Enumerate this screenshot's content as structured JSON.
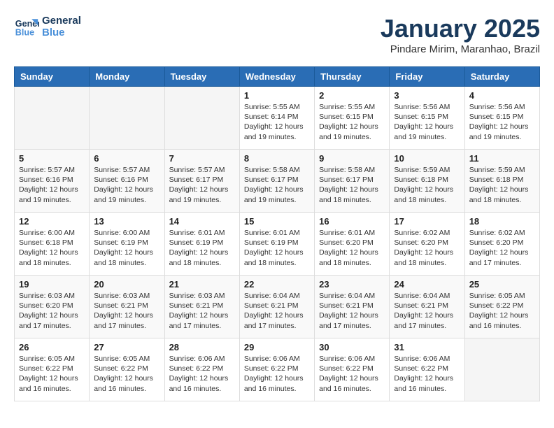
{
  "logo": {
    "line1": "General",
    "line2": "Blue"
  },
  "title": "January 2025",
  "location": "Pindare Mirim, Maranhao, Brazil",
  "weekdays": [
    "Sunday",
    "Monday",
    "Tuesday",
    "Wednesday",
    "Thursday",
    "Friday",
    "Saturday"
  ],
  "weeks": [
    [
      {
        "day": "",
        "text": ""
      },
      {
        "day": "",
        "text": ""
      },
      {
        "day": "",
        "text": ""
      },
      {
        "day": "1",
        "text": "Sunrise: 5:55 AM\nSunset: 6:14 PM\nDaylight: 12 hours\nand 19 minutes."
      },
      {
        "day": "2",
        "text": "Sunrise: 5:55 AM\nSunset: 6:15 PM\nDaylight: 12 hours\nand 19 minutes."
      },
      {
        "day": "3",
        "text": "Sunrise: 5:56 AM\nSunset: 6:15 PM\nDaylight: 12 hours\nand 19 minutes."
      },
      {
        "day": "4",
        "text": "Sunrise: 5:56 AM\nSunset: 6:15 PM\nDaylight: 12 hours\nand 19 minutes."
      }
    ],
    [
      {
        "day": "5",
        "text": "Sunrise: 5:57 AM\nSunset: 6:16 PM\nDaylight: 12 hours\nand 19 minutes."
      },
      {
        "day": "6",
        "text": "Sunrise: 5:57 AM\nSunset: 6:16 PM\nDaylight: 12 hours\nand 19 minutes."
      },
      {
        "day": "7",
        "text": "Sunrise: 5:57 AM\nSunset: 6:17 PM\nDaylight: 12 hours\nand 19 minutes."
      },
      {
        "day": "8",
        "text": "Sunrise: 5:58 AM\nSunset: 6:17 PM\nDaylight: 12 hours\nand 19 minutes."
      },
      {
        "day": "9",
        "text": "Sunrise: 5:58 AM\nSunset: 6:17 PM\nDaylight: 12 hours\nand 18 minutes."
      },
      {
        "day": "10",
        "text": "Sunrise: 5:59 AM\nSunset: 6:18 PM\nDaylight: 12 hours\nand 18 minutes."
      },
      {
        "day": "11",
        "text": "Sunrise: 5:59 AM\nSunset: 6:18 PM\nDaylight: 12 hours\nand 18 minutes."
      }
    ],
    [
      {
        "day": "12",
        "text": "Sunrise: 6:00 AM\nSunset: 6:18 PM\nDaylight: 12 hours\nand 18 minutes."
      },
      {
        "day": "13",
        "text": "Sunrise: 6:00 AM\nSunset: 6:19 PM\nDaylight: 12 hours\nand 18 minutes."
      },
      {
        "day": "14",
        "text": "Sunrise: 6:01 AM\nSunset: 6:19 PM\nDaylight: 12 hours\nand 18 minutes."
      },
      {
        "day": "15",
        "text": "Sunrise: 6:01 AM\nSunset: 6:19 PM\nDaylight: 12 hours\nand 18 minutes."
      },
      {
        "day": "16",
        "text": "Sunrise: 6:01 AM\nSunset: 6:20 PM\nDaylight: 12 hours\nand 18 minutes."
      },
      {
        "day": "17",
        "text": "Sunrise: 6:02 AM\nSunset: 6:20 PM\nDaylight: 12 hours\nand 18 minutes."
      },
      {
        "day": "18",
        "text": "Sunrise: 6:02 AM\nSunset: 6:20 PM\nDaylight: 12 hours\nand 17 minutes."
      }
    ],
    [
      {
        "day": "19",
        "text": "Sunrise: 6:03 AM\nSunset: 6:20 PM\nDaylight: 12 hours\nand 17 minutes."
      },
      {
        "day": "20",
        "text": "Sunrise: 6:03 AM\nSunset: 6:21 PM\nDaylight: 12 hours\nand 17 minutes."
      },
      {
        "day": "21",
        "text": "Sunrise: 6:03 AM\nSunset: 6:21 PM\nDaylight: 12 hours\nand 17 minutes."
      },
      {
        "day": "22",
        "text": "Sunrise: 6:04 AM\nSunset: 6:21 PM\nDaylight: 12 hours\nand 17 minutes."
      },
      {
        "day": "23",
        "text": "Sunrise: 6:04 AM\nSunset: 6:21 PM\nDaylight: 12 hours\nand 17 minutes."
      },
      {
        "day": "24",
        "text": "Sunrise: 6:04 AM\nSunset: 6:21 PM\nDaylight: 12 hours\nand 17 minutes."
      },
      {
        "day": "25",
        "text": "Sunrise: 6:05 AM\nSunset: 6:22 PM\nDaylight: 12 hours\nand 16 minutes."
      }
    ],
    [
      {
        "day": "26",
        "text": "Sunrise: 6:05 AM\nSunset: 6:22 PM\nDaylight: 12 hours\nand 16 minutes."
      },
      {
        "day": "27",
        "text": "Sunrise: 6:05 AM\nSunset: 6:22 PM\nDaylight: 12 hours\nand 16 minutes."
      },
      {
        "day": "28",
        "text": "Sunrise: 6:06 AM\nSunset: 6:22 PM\nDaylight: 12 hours\nand 16 minutes."
      },
      {
        "day": "29",
        "text": "Sunrise: 6:06 AM\nSunset: 6:22 PM\nDaylight: 12 hours\nand 16 minutes."
      },
      {
        "day": "30",
        "text": "Sunrise: 6:06 AM\nSunset: 6:22 PM\nDaylight: 12 hours\nand 16 minutes."
      },
      {
        "day": "31",
        "text": "Sunrise: 6:06 AM\nSunset: 6:22 PM\nDaylight: 12 hours\nand 16 minutes."
      },
      {
        "day": "",
        "text": ""
      }
    ]
  ]
}
